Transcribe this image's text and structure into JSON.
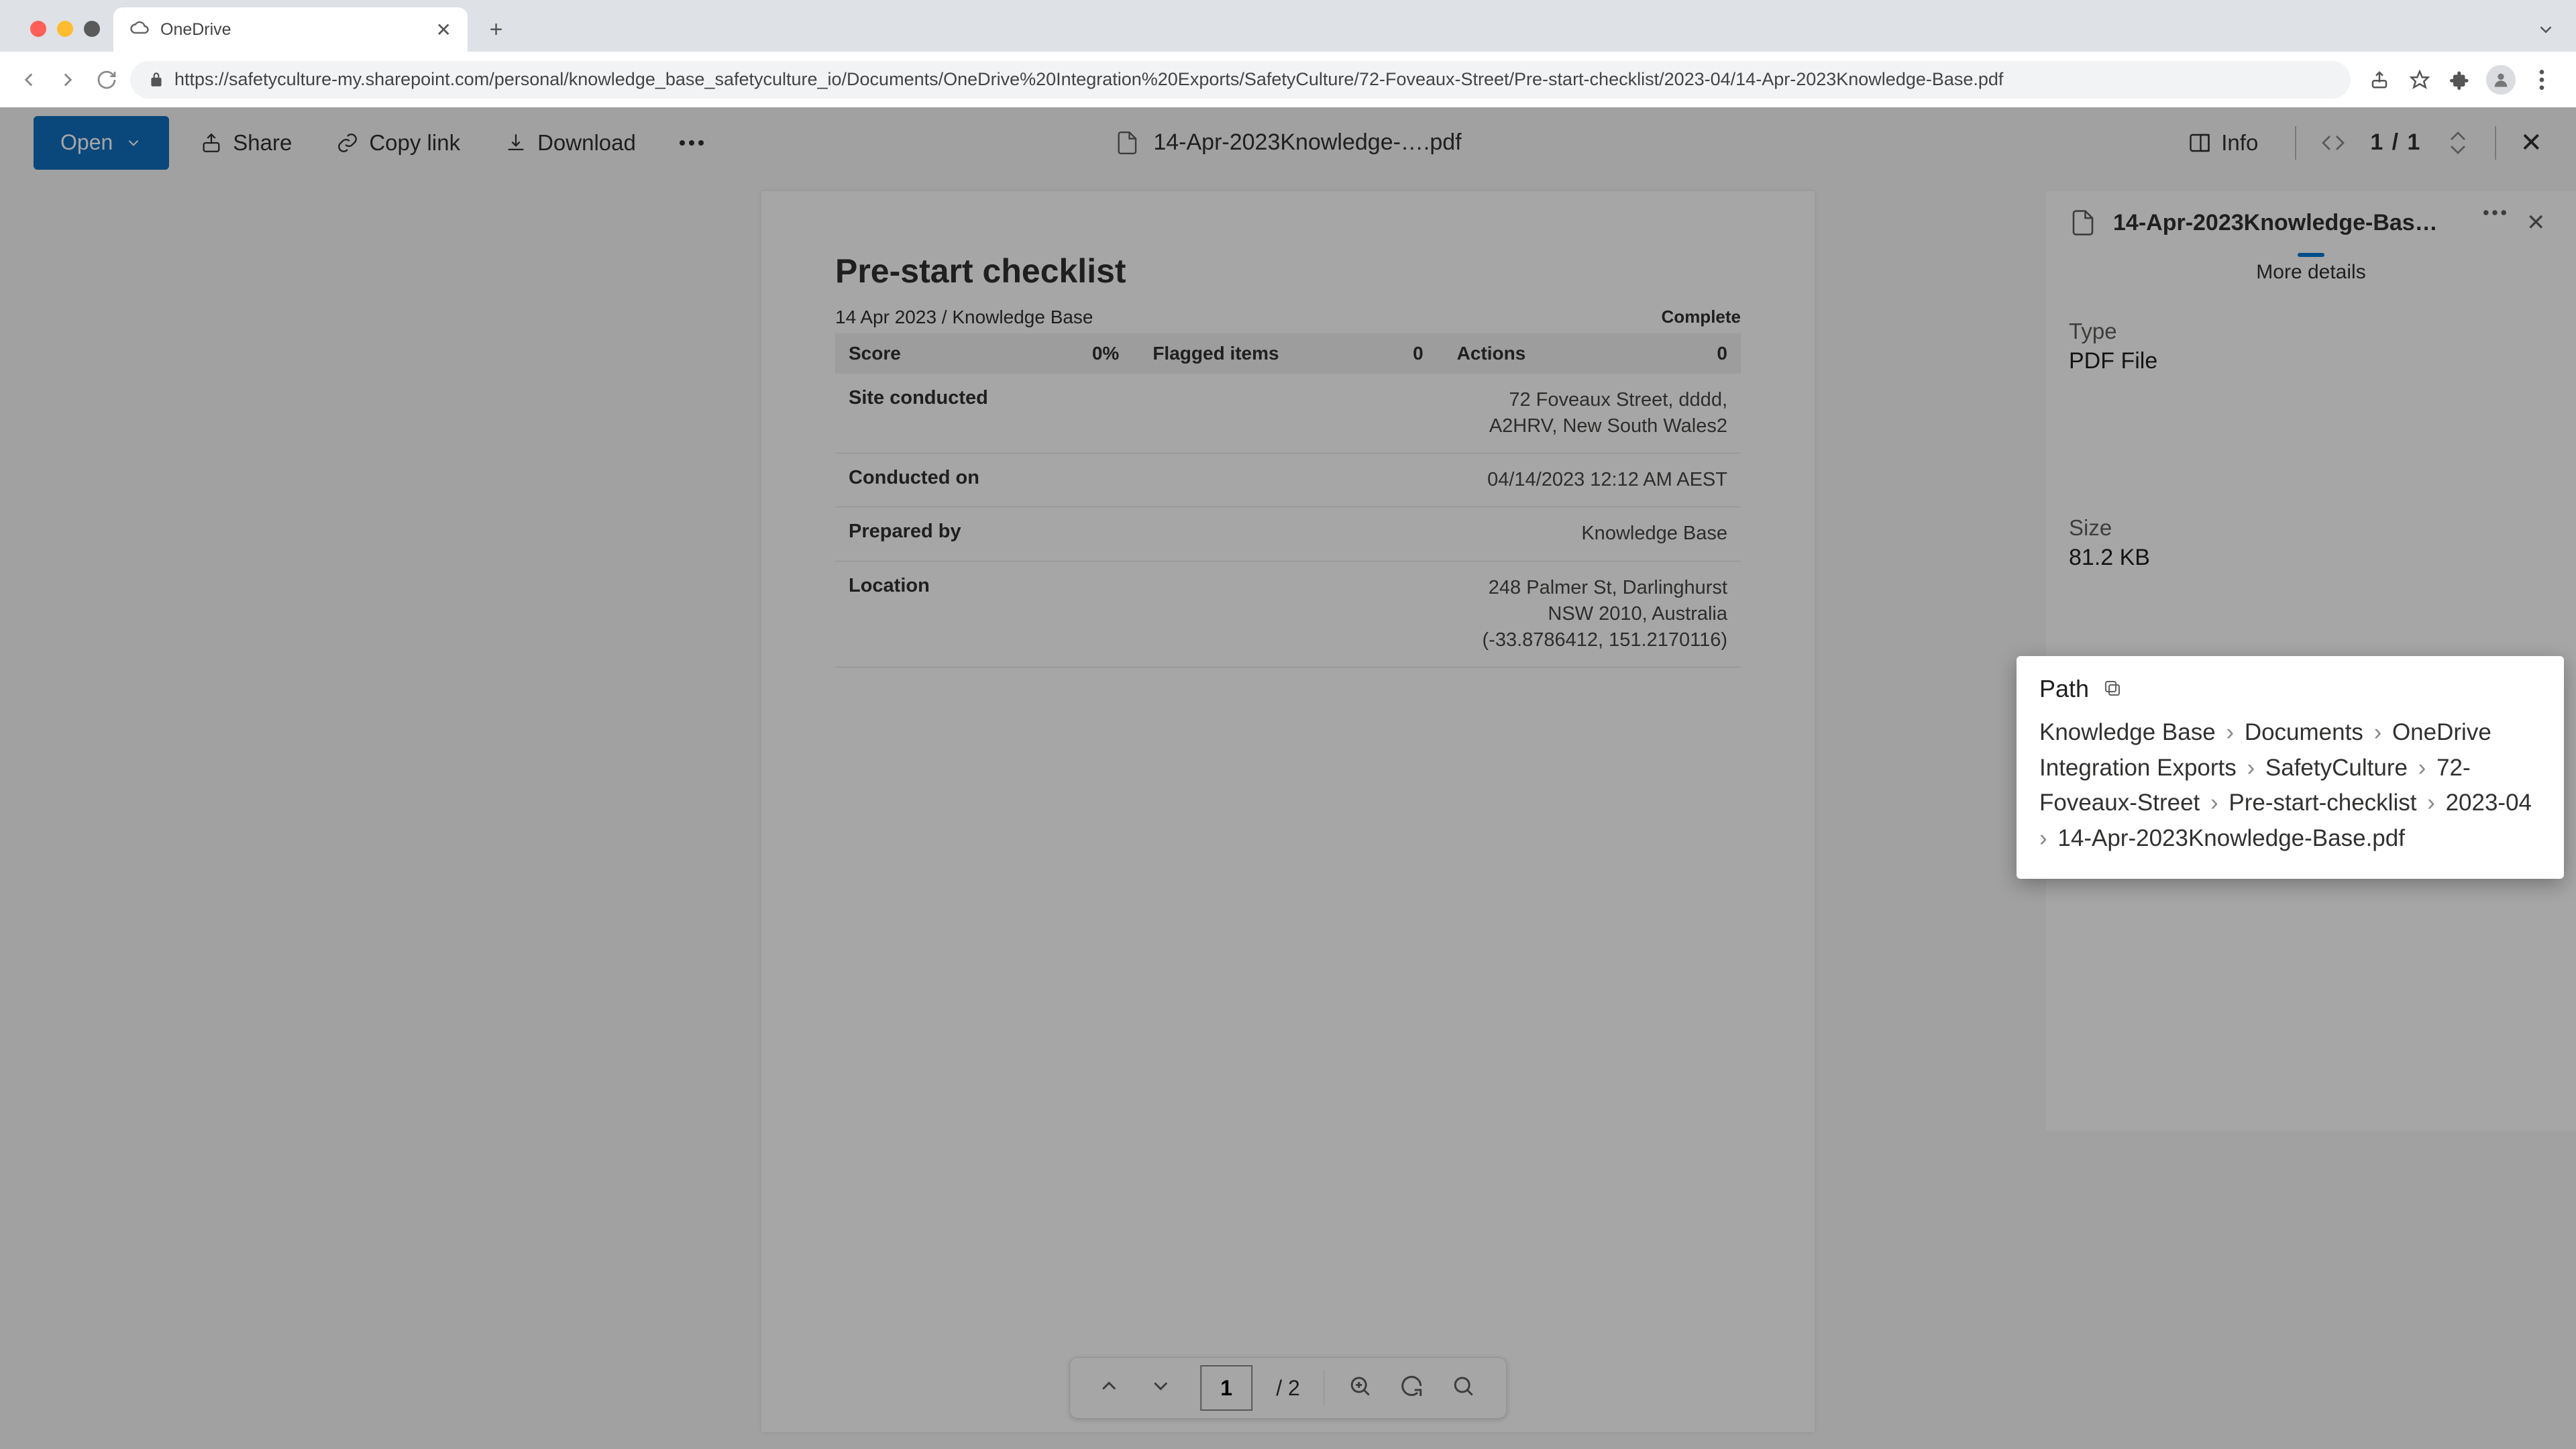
{
  "browser": {
    "tab_title": "OneDrive",
    "url": "https://safetyculture-my.sharepoint.com/personal/knowledge_base_safetyculture_io/Documents/OneDrive%20Integration%20Exports/SafetyCulture/72-Foveaux-Street/Pre-start-checklist/2023-04/14-Apr-2023Knowledge-Base.pdf"
  },
  "cmdbar": {
    "open": "Open",
    "share": "Share",
    "copy_link": "Copy link",
    "download": "Download",
    "info": "Info",
    "file_name": "14-Apr-2023Knowledge-….pdf",
    "page_indicator": "1 / 1"
  },
  "doc": {
    "title": "Pre-start checklist",
    "date_author": "14 Apr 2023 / Knowledge Base",
    "status": "Complete",
    "score_label": "Score",
    "score_value": "0%",
    "flagged_label": "Flagged items",
    "flagged_value": "0",
    "actions_label": "Actions",
    "actions_value": "0",
    "rows": {
      "site_label": "Site conducted",
      "site_value": "72 Foveaux Street, dddd,\nA2HRV, New South Wales2",
      "cond_label": "Conducted on",
      "cond_value": "04/14/2023 12:12 AM AEST",
      "prep_label": "Prepared by",
      "prep_value": "Knowledge Base",
      "loc_label": "Location",
      "loc_value": "248 Palmer St, Darlinghurst\nNSW 2010, Australia\n(-33.8786412, 151.2170116)"
    }
  },
  "pdf_toolbar": {
    "page_input": "1",
    "page_total": "/ 2"
  },
  "details": {
    "title": "14-Apr-2023Knowledge-Bas…",
    "more": "More details",
    "type_label": "Type",
    "type_value": "PDF File",
    "size_label": "Size",
    "size_value": "81.2 KB"
  },
  "path": {
    "label": "Path",
    "segments": [
      "Knowledge Base",
      "Documents",
      "OneDrive Integration Exports",
      "SafetyCulture",
      "72-Foveaux-Street",
      "Pre-start-checklist",
      "2023-04",
      "14-Apr-2023Knowledge-Base.pdf"
    ]
  }
}
